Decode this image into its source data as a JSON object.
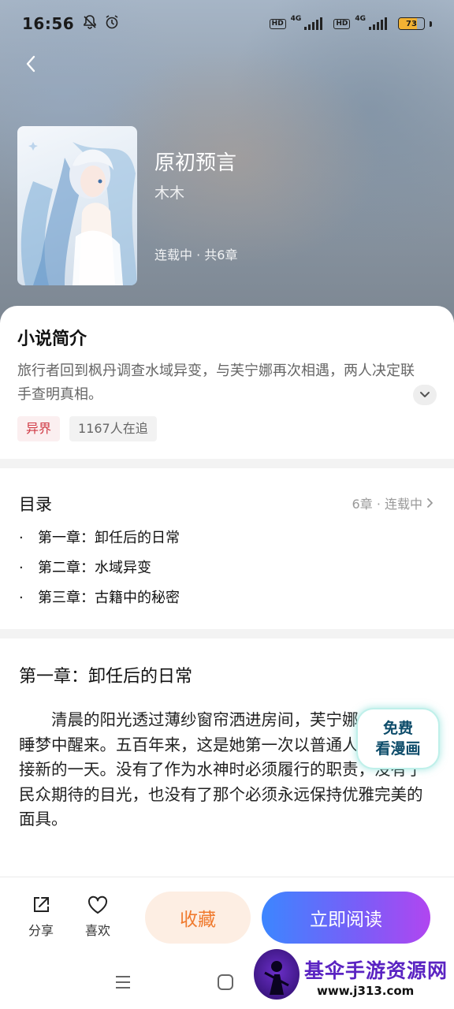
{
  "status_bar": {
    "time": "16:56",
    "network_1": "4G",
    "network_2": "4G",
    "battery_level": "73",
    "battery_fraction": 0.73,
    "icons": [
      "mute-bell-icon",
      "alarm-icon",
      "hd-icon",
      "signal-icon",
      "battery-icon"
    ]
  },
  "book": {
    "title": "原初预言",
    "author": "木木",
    "meta": "连载中 · 共6章"
  },
  "intro": {
    "heading": "小说简介",
    "text": "旅行者回到枫丹调查水域异变，与芙宁娜再次相遇，两人决定联手查明真相。",
    "tags": [
      "异界",
      "1167人在追"
    ]
  },
  "toc": {
    "heading": "目录",
    "meta": "6章 · 连载中",
    "items": [
      "第一章：卸任后的日常",
      "第二章：水域异变",
      "第三章：古籍中的秘密"
    ]
  },
  "chapter": {
    "title": "第一章：卸任后的日常",
    "body": "清晨的阳光透过薄纱窗帘洒进房间，芙宁娜·德·枫丹从睡梦中醒来。五百年来，这是她第一次以普通人的身份迎接新的一天。没有了作为水神时必须履行的职责，没有了民众期待的目光，也没有了那个必须永远保持优雅完美的面具。"
  },
  "comic_button": {
    "line1": "免费",
    "line2": "看漫画"
  },
  "actions": {
    "share_label": "分享",
    "like_label": "喜欢",
    "favorite_label": "收藏",
    "read_label": "立即阅读"
  },
  "watermark": {
    "name": "基伞手游资源网",
    "url": "www.j313.com"
  },
  "colors": {
    "accent_orange": "#f07a2e",
    "read_gradient_start": "#3c86ff",
    "read_gradient_end": "#b146f0",
    "tag_red": "#d03a45"
  }
}
